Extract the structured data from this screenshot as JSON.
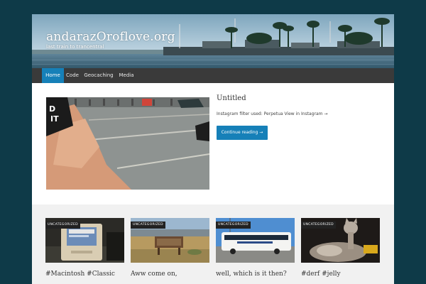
{
  "site": {
    "title": "andarazOroflove.org",
    "tagline": "last train to trancentral"
  },
  "nav": {
    "items": [
      {
        "label": "Home",
        "active": true
      },
      {
        "label": "Code",
        "active": false
      },
      {
        "label": "Geocaching",
        "active": false
      },
      {
        "label": "Media",
        "active": false
      }
    ]
  },
  "featured": {
    "title": "Untitled",
    "excerpt": "Instagram filter used: Perpetua View in Instagram →",
    "continue_label": "Continue reading →"
  },
  "cards": [
    {
      "category": "UNCATEGORIZED",
      "title": "#Macintosh #Classic"
    },
    {
      "category": "UNCATEGORIZED",
      "title": "Aww come on,"
    },
    {
      "category": "UNCATEGORIZED",
      "title": "well, which is it then?"
    },
    {
      "category": "UNCATEGORIZED",
      "title": "#derf #jelly"
    }
  ],
  "colors": {
    "background": "#0e3a48",
    "accent": "#1680b8",
    "nav": "#3a3a3a"
  }
}
